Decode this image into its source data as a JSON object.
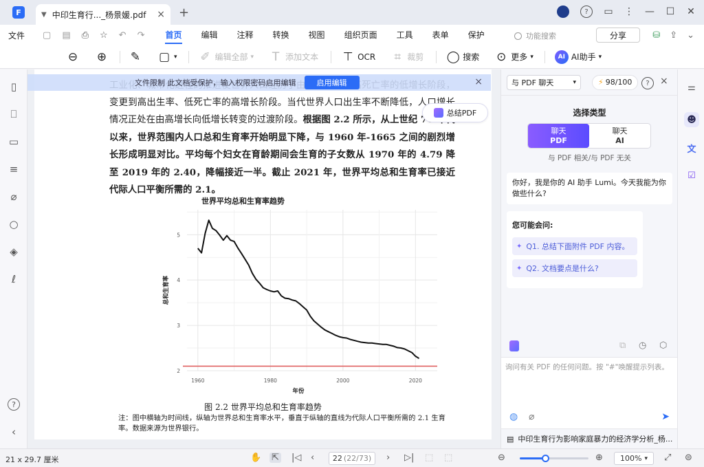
{
  "titlebar": {
    "logo": "F",
    "tab_title": "中印生育行..._杨景媛.pdf",
    "tab_close": "×",
    "new_tab": "+"
  },
  "menubar": {
    "file": "文件",
    "items": [
      {
        "label": "首页",
        "active": true
      },
      {
        "label": "编辑"
      },
      {
        "label": "注释"
      },
      {
        "label": "转换"
      },
      {
        "label": "视图"
      },
      {
        "label": "组织页面"
      },
      {
        "label": "工具"
      },
      {
        "label": "表单"
      },
      {
        "label": "保护"
      }
    ],
    "search_placeholder": "功能搜索",
    "share": "分享"
  },
  "toolbar": {
    "edit_all": "编辑全部",
    "add_text": "添加文本",
    "ocr": "OCR",
    "crop": "裁剪",
    "search": "搜索",
    "more": "更多",
    "ai_badge": "AI",
    "ai_assistant": "AI助手"
  },
  "banner": {
    "text": "文件限制    此文档受保护，输入权限密码启用编辑",
    "button": "启用编辑",
    "close": "×"
  },
  "summarize": {
    "label": "总结PDF"
  },
  "document": {
    "para1": "工业化、城市化进程的推进使世界人口经历了由高出生率、高死亡率的低增长阶段，变更到高出生率、低死亡率的高增长阶段。当代世界人口出生率不断降低，人口增长情况正处在由高增长向低增长转变的过渡阶段。",
    "para1_bold": "根据图 2.2 所示，从上世纪 70 年代以来，世界范围内人口总和生育率开始明显下降，与 1960 年-1665 之间的剧烈增长形成明显对比。平均每个妇女在育龄期间会生育的子女数从 1970 年的 4.79 降至 2019 年的 2.40，降幅接近一半。截止 2021 年，世界平均总和生育率已接近代际人口平衡所需的 2.1。",
    "figure_caption": "图 2.2    世界平均总和生育率趋势",
    "figure_note": "注：图中横轴为时间线，纵轴为世界总和生育率水平，垂直于纵轴的直线为代际人口平衡所需的 2.1 生育率。数据来源为世界银行。"
  },
  "chart_data": {
    "type": "line",
    "title": "世界平均总和生育率趋势",
    "xlabel": "年份",
    "ylabel": "总和生育率",
    "xlim": [
      1957,
      2026
    ],
    "ylim": [
      2,
      5.55
    ],
    "xticks": [
      1960,
      1980,
      2000,
      2020
    ],
    "yticks": [
      2,
      3,
      4,
      5
    ],
    "grid": true,
    "series": [
      {
        "x": [
          1960,
          1961,
          1962,
          1963,
          1964,
          1965,
          1966,
          1967,
          1968,
          1969,
          1970,
          1971,
          1972,
          1973,
          1974,
          1975,
          1976,
          1977,
          1978,
          1979,
          1980,
          1981,
          1982,
          1983,
          1984,
          1985,
          1986,
          1987,
          1988,
          1989,
          1990,
          1991,
          1992,
          1993,
          1994,
          1995,
          1996,
          1997,
          1998,
          1999,
          2000,
          2001,
          2002,
          2003,
          2004,
          2005,
          2006,
          2007,
          2008,
          2009,
          2010,
          2011,
          2012,
          2013,
          2014,
          2015,
          2016,
          2017,
          2018,
          2019,
          2020,
          2021
        ],
        "y": [
          4.7,
          4.6,
          5.03,
          5.32,
          5.14,
          5.09,
          4.99,
          4.88,
          4.98,
          4.88,
          4.85,
          4.71,
          4.59,
          4.46,
          4.33,
          4.15,
          4.02,
          3.93,
          3.83,
          3.79,
          3.76,
          3.74,
          3.76,
          3.65,
          3.6,
          3.59,
          3.56,
          3.54,
          3.48,
          3.41,
          3.34,
          3.2,
          3.1,
          3.03,
          2.96,
          2.9,
          2.86,
          2.82,
          2.78,
          2.75,
          2.73,
          2.72,
          2.69,
          2.67,
          2.65,
          2.63,
          2.62,
          2.61,
          2.61,
          2.6,
          2.59,
          2.58,
          2.58,
          2.56,
          2.54,
          2.51,
          2.5,
          2.48,
          2.44,
          2.4,
          2.32,
          2.27
        ],
        "color": "#111111"
      }
    ],
    "reference_line": {
      "y": 2.1,
      "color": "#e06060"
    }
  },
  "right_panel": {
    "chat_mode": "与 PDF 聊天",
    "credits": "98/100",
    "close": "×",
    "choose_type": "选择类型",
    "option_pdf_top": "聊天",
    "option_pdf_sub": "PDF",
    "option_ai_top": "聊天",
    "option_ai_sub": "AI",
    "type_hint": "与 PDF 相关/与 PDF 无关",
    "greeting": "你好，我是你的 AI 助手 Lumi。今天我能为你做些什么?",
    "ask_title": "您可能会问:",
    "questions": [
      "Q1. 总结下面附件 PDF 内容。",
      "Q2. 文档要点是什么?"
    ],
    "input_placeholder": "询问有关 PDF 的任何问题。按 \"#\"唤醒提示列表。",
    "attached_file": "中印生育行为影响家庭暴力的经济学分析_杨..."
  },
  "statusbar": {
    "page_size": "21 x 29.7 厘米",
    "current_page": "22",
    "page_total": "(22/73)",
    "zoom": "100%"
  },
  "colors": {
    "accent": "#2b6cf6",
    "ai_gradient_start": "#8a5cff",
    "reference_line": "#e06060"
  }
}
